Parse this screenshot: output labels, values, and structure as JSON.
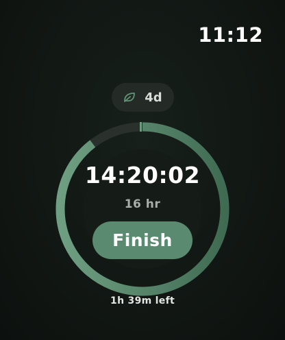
{
  "status_bar": {
    "time": "11:12"
  },
  "streak": {
    "icon": "leaf-icon",
    "label": "4d"
  },
  "fast": {
    "elapsed": "14:20:02",
    "goal": "16 hr",
    "progress_fraction": 0.896,
    "time_left": "1h 39m left"
  },
  "actions": {
    "finish_label": "Finish"
  },
  "colors": {
    "accent": "#5a8b70",
    "ring_progress": "#4f7e63",
    "ring_track": "#2a312d",
    "background": "#111713"
  }
}
